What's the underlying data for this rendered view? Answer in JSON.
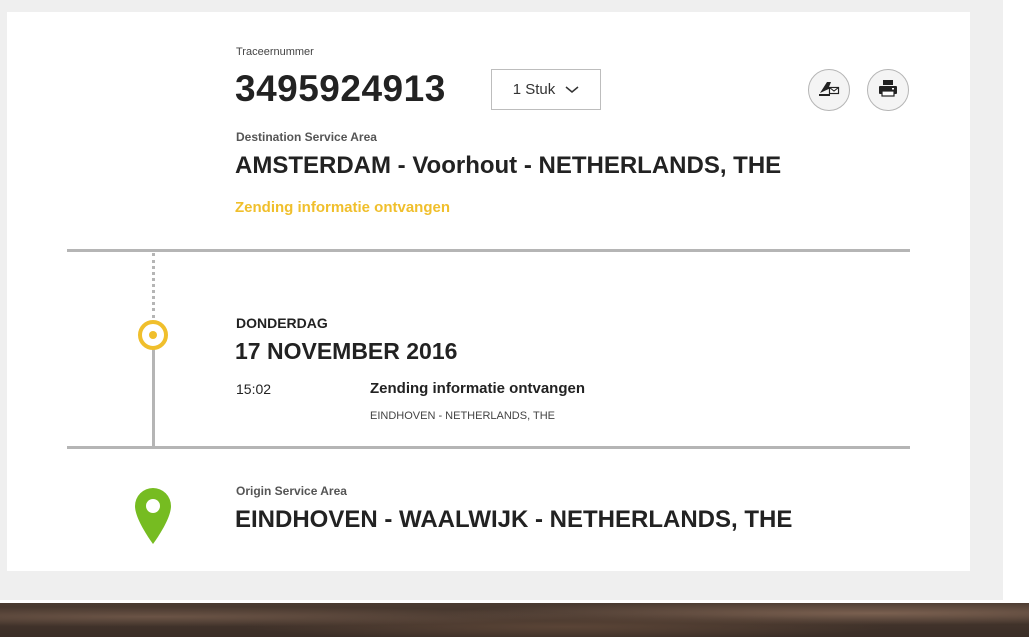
{
  "shipment": {
    "tracking_label": "Traceernummer",
    "tracking_number": "3495924913",
    "pieces_select": "1 Stuk",
    "destination_label": "Destination Service Area",
    "destination": "AMSTERDAM - Voorhout - NETHERLANDS, THE",
    "status": "Zending informatie ontvangen",
    "status_color": "#f0bf2c",
    "actions": {
      "notify_icon": "notify-by-email-icon",
      "print_icon": "printer-icon"
    }
  },
  "timeline": {
    "day": "DONDERDAG",
    "date": "17 NOVEMBER 2016",
    "marker_color": "#f0bf2c",
    "events": [
      {
        "time": "15:02",
        "title": "Zending informatie ontvangen",
        "location": "EINDHOVEN - NETHERLANDS, THE"
      }
    ]
  },
  "origin": {
    "label": "Origin Service Area",
    "value": "EINDHOVEN - WAALWIJK - NETHERLANDS, THE",
    "pin_color": "#76bc21"
  }
}
